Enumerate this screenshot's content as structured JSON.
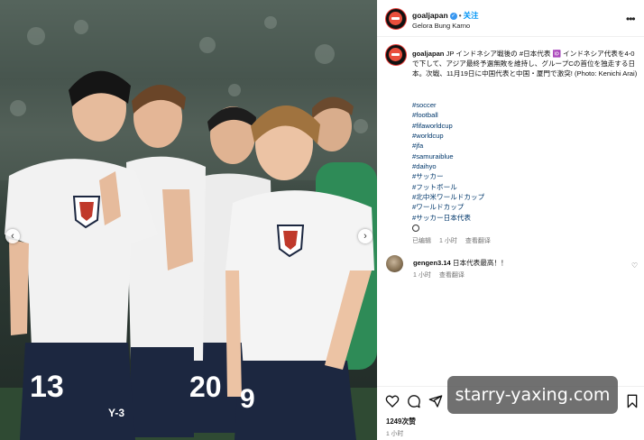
{
  "header": {
    "username": "goaljapan",
    "follow_label": "关注",
    "location": "Gelora Bung Karno",
    "more_icon": "more-horizontal-icon"
  },
  "caption": {
    "username": "goaljapan",
    "text": "JP インドネシア戦後の #日本代表 🆔 インドネシア代表を4-0で下して、アジア最終予選無敗を維持し、グループCの首位を独走する日本。次戦、11月19日に中国代表と中国・厦門で激突! (Photo: Kenichi Arai)",
    "hashtags": [
      "#soccer",
      "#football",
      "#fifaworldcup",
      "#worldcup",
      "#jfa",
      "#samuraiblue",
      "#daihyo",
      "#サッカー",
      "#フットボール",
      "#北中米ワールドカップ",
      "#ワールドカップ",
      "#サッカー日本代表"
    ],
    "edited_label": "已编辑",
    "time_label": "1 小时",
    "translation_label": "查看翻译"
  },
  "comment": {
    "username": "gengen3.14",
    "text": "日本代表最高！！",
    "time_label": "1 小时",
    "translation_label": "查看翻译"
  },
  "footer": {
    "likes_label": "1249次赞",
    "time_label": "1 小时",
    "icons": [
      "heart-icon",
      "comment-icon",
      "share-icon",
      "bookmark-icon"
    ]
  },
  "watermark": "starry-yaxing.com",
  "players": {
    "numbers": [
      "13",
      "20",
      "9"
    ],
    "brand": "Y-3"
  },
  "colors": {
    "accent_link": "#0095f6",
    "hashtag": "#00376b",
    "verified": "#3897f0",
    "jersey": "#eeeeee",
    "shorts": "#1c2740"
  }
}
